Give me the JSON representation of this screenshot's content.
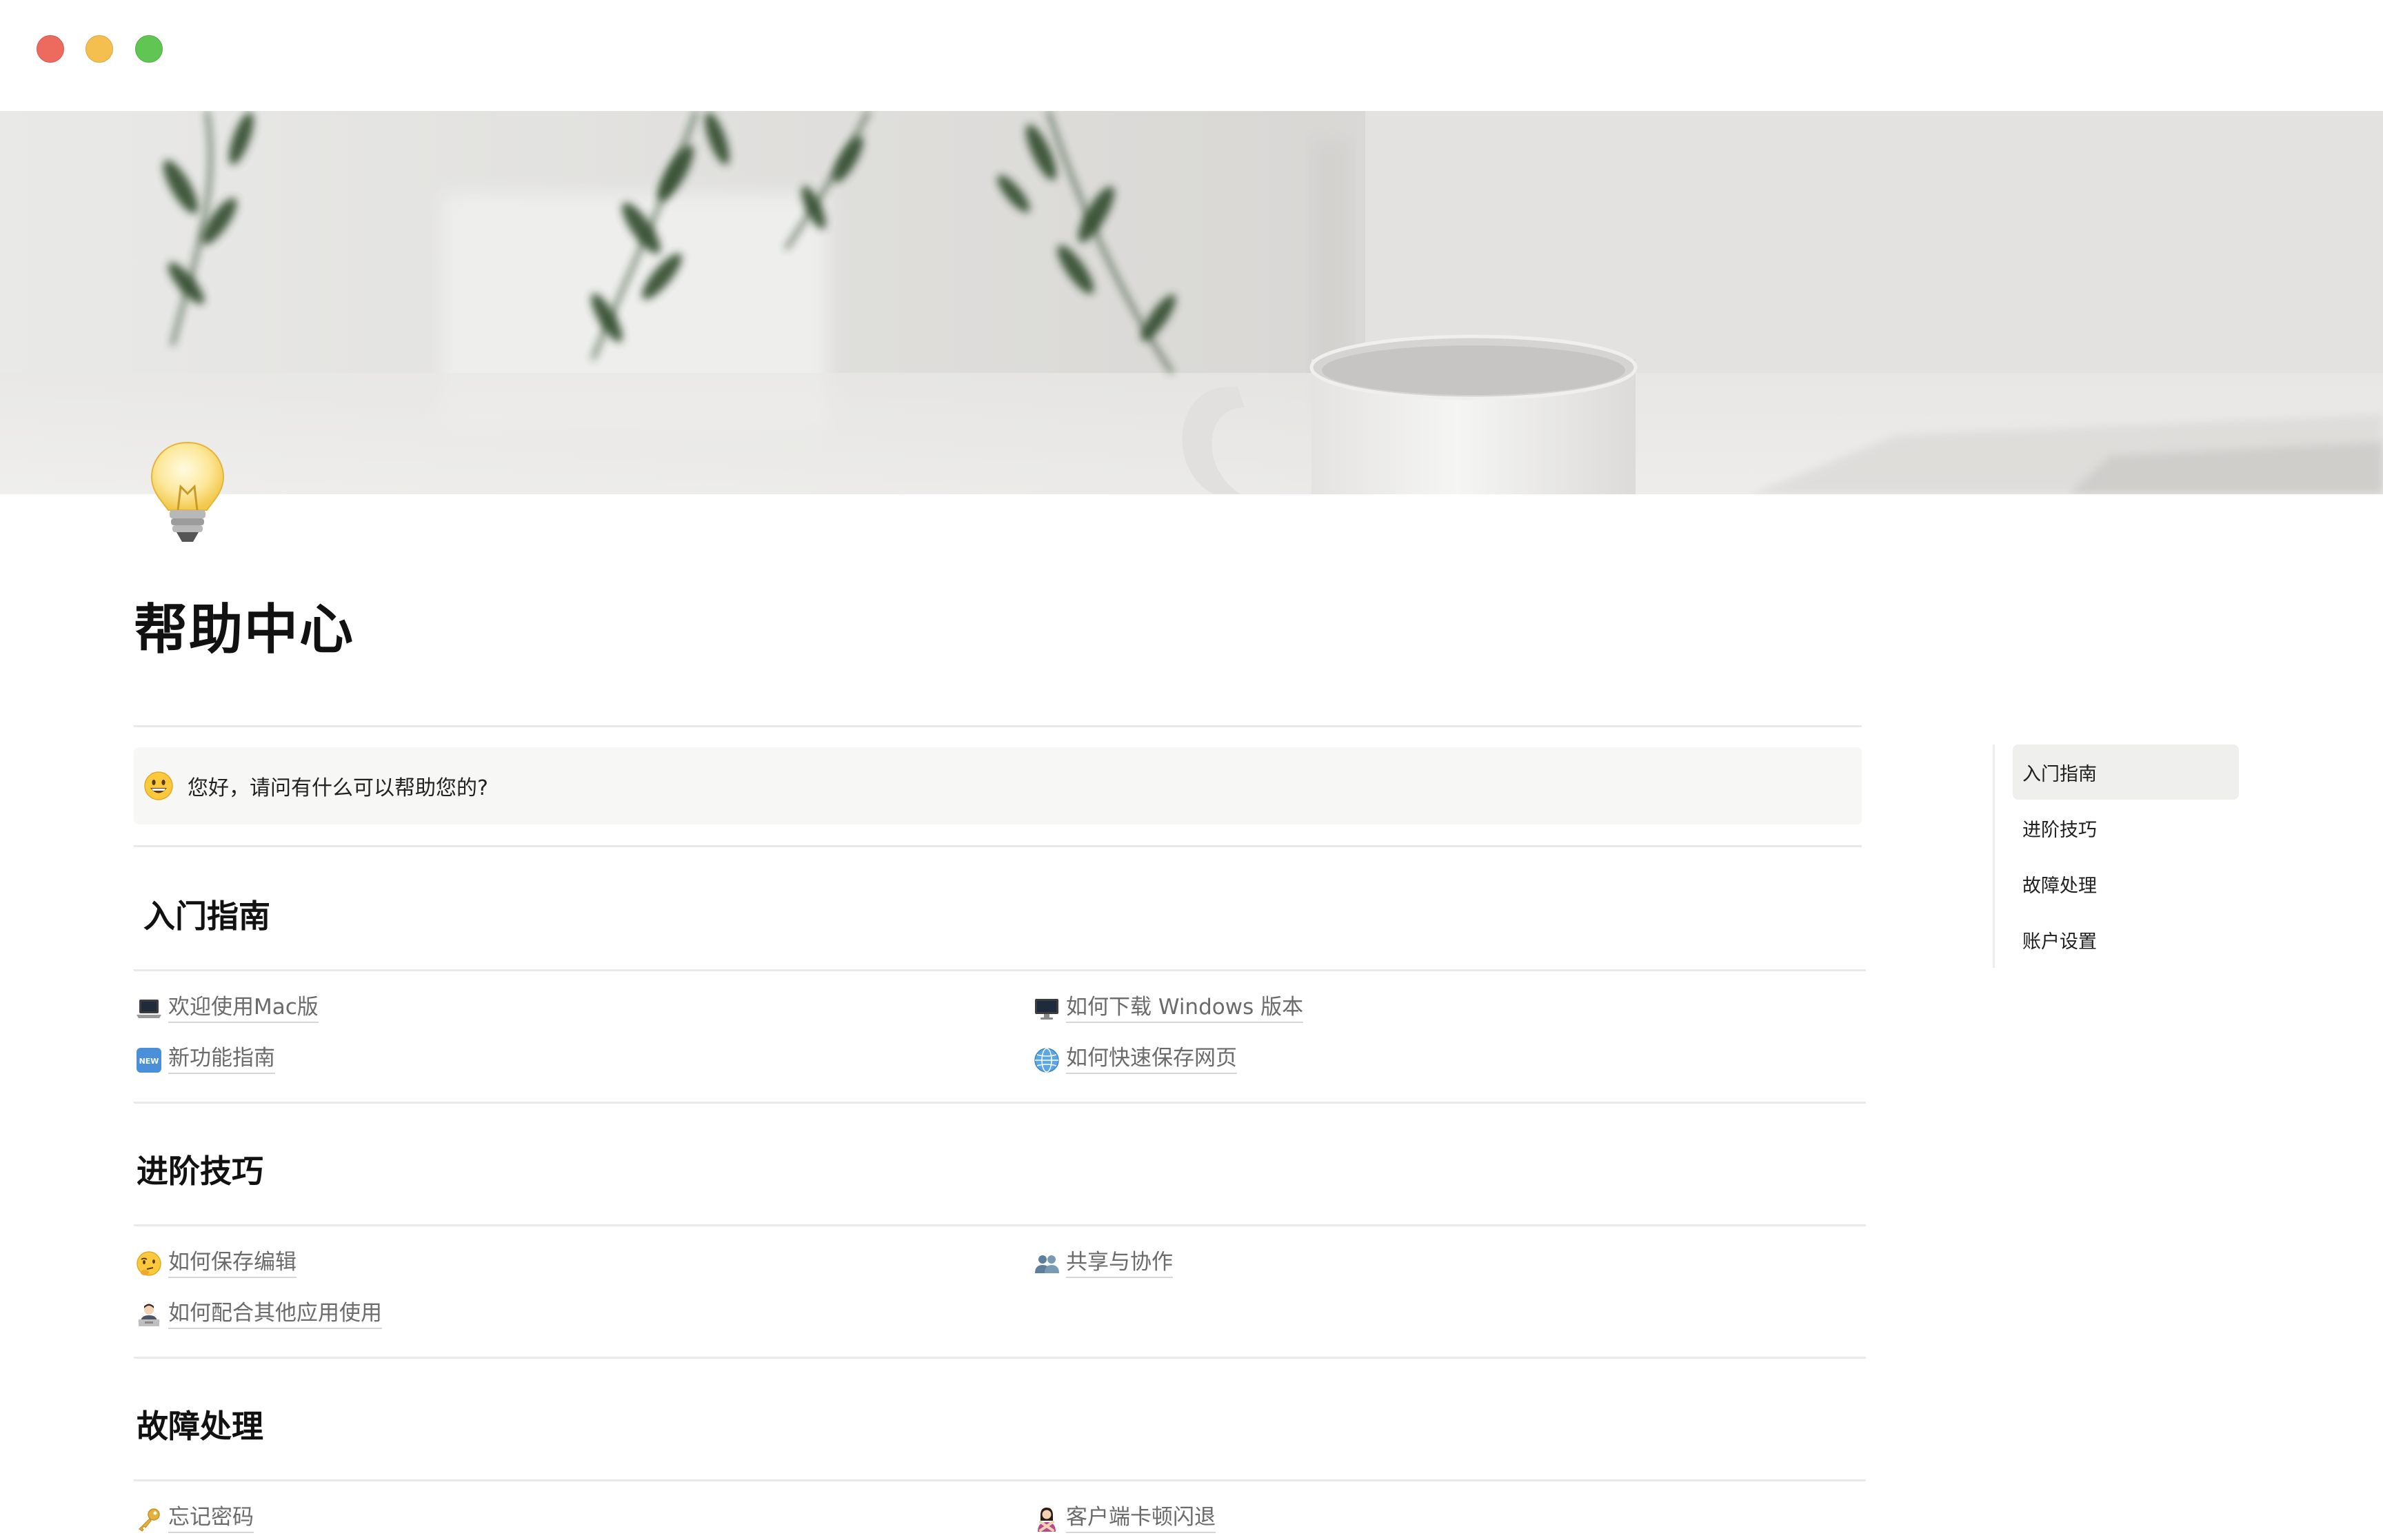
{
  "page": {
    "title": "帮助中心",
    "icon": "lightbulb-icon"
  },
  "callout": {
    "icon": "grinning-face-icon",
    "text": "您好，请问有什么可以帮助您的?"
  },
  "sections": [
    {
      "heading": "入门指南",
      "links": [
        {
          "icon": "laptop-icon",
          "label": "欢迎使用Mac版"
        },
        {
          "icon": "desktop-computer-icon",
          "label": "如何下载 Windows 版本"
        },
        {
          "icon": "new-badge-icon",
          "label": "新功能指南"
        },
        {
          "icon": "globe-icon",
          "label": "如何快速保存网页"
        }
      ]
    },
    {
      "heading": "进阶技巧",
      "links": [
        {
          "icon": "thinking-face-icon",
          "label": "如何保存编辑"
        },
        {
          "icon": "people-icon",
          "label": "共享与协作"
        },
        {
          "icon": "technologist-icon",
          "label": "如何配合其他应用使用"
        }
      ]
    },
    {
      "heading": "故障处理",
      "links": [
        {
          "icon": "key-icon",
          "label": "忘记密码"
        },
        {
          "icon": "person-gesturing-no-icon",
          "label": "客户端卡顿闪退"
        }
      ]
    }
  ],
  "toc": {
    "items": [
      "入门指南",
      "进阶技巧",
      "故障处理",
      "账户设置"
    ],
    "active_index": 0
  },
  "colors": {
    "traffic_red": "#ed6a5e",
    "traffic_yellow": "#f5bf4f",
    "traffic_green": "#61c554",
    "link_text": "#6b6b6b",
    "callout_bg": "#f7f7f5"
  }
}
